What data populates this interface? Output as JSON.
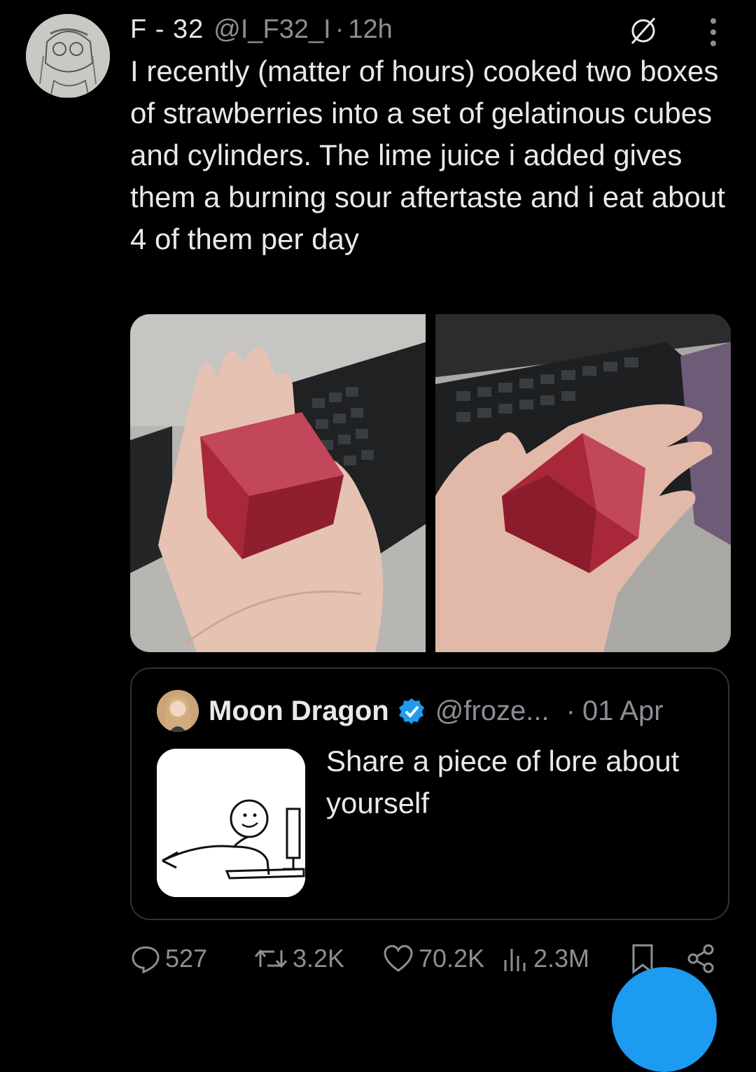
{
  "tweet": {
    "display_name": "F - 32",
    "handle": "@I_F32_I",
    "separator": "·",
    "time": "12h",
    "text": "I recently (matter of hours) cooked two boxes of strawberries into a set of gelatinous cubes and cylinders. The lime juice i added gives them a burning sour aftertaste and i eat about 4 of them per day"
  },
  "quote": {
    "name": "Moon Dragon",
    "handle": "@froze...",
    "separator": "·",
    "date": "01 Apr",
    "text": "Share a piece of lore about yourself"
  },
  "actions": {
    "replies": "527",
    "retweets": "3.2K",
    "likes": "70.2K",
    "views": "2.3M"
  },
  "colors": {
    "background": "#000000",
    "text": "#e7e9ea",
    "muted": "#8b8f94",
    "accent": "#1d9bf0"
  }
}
